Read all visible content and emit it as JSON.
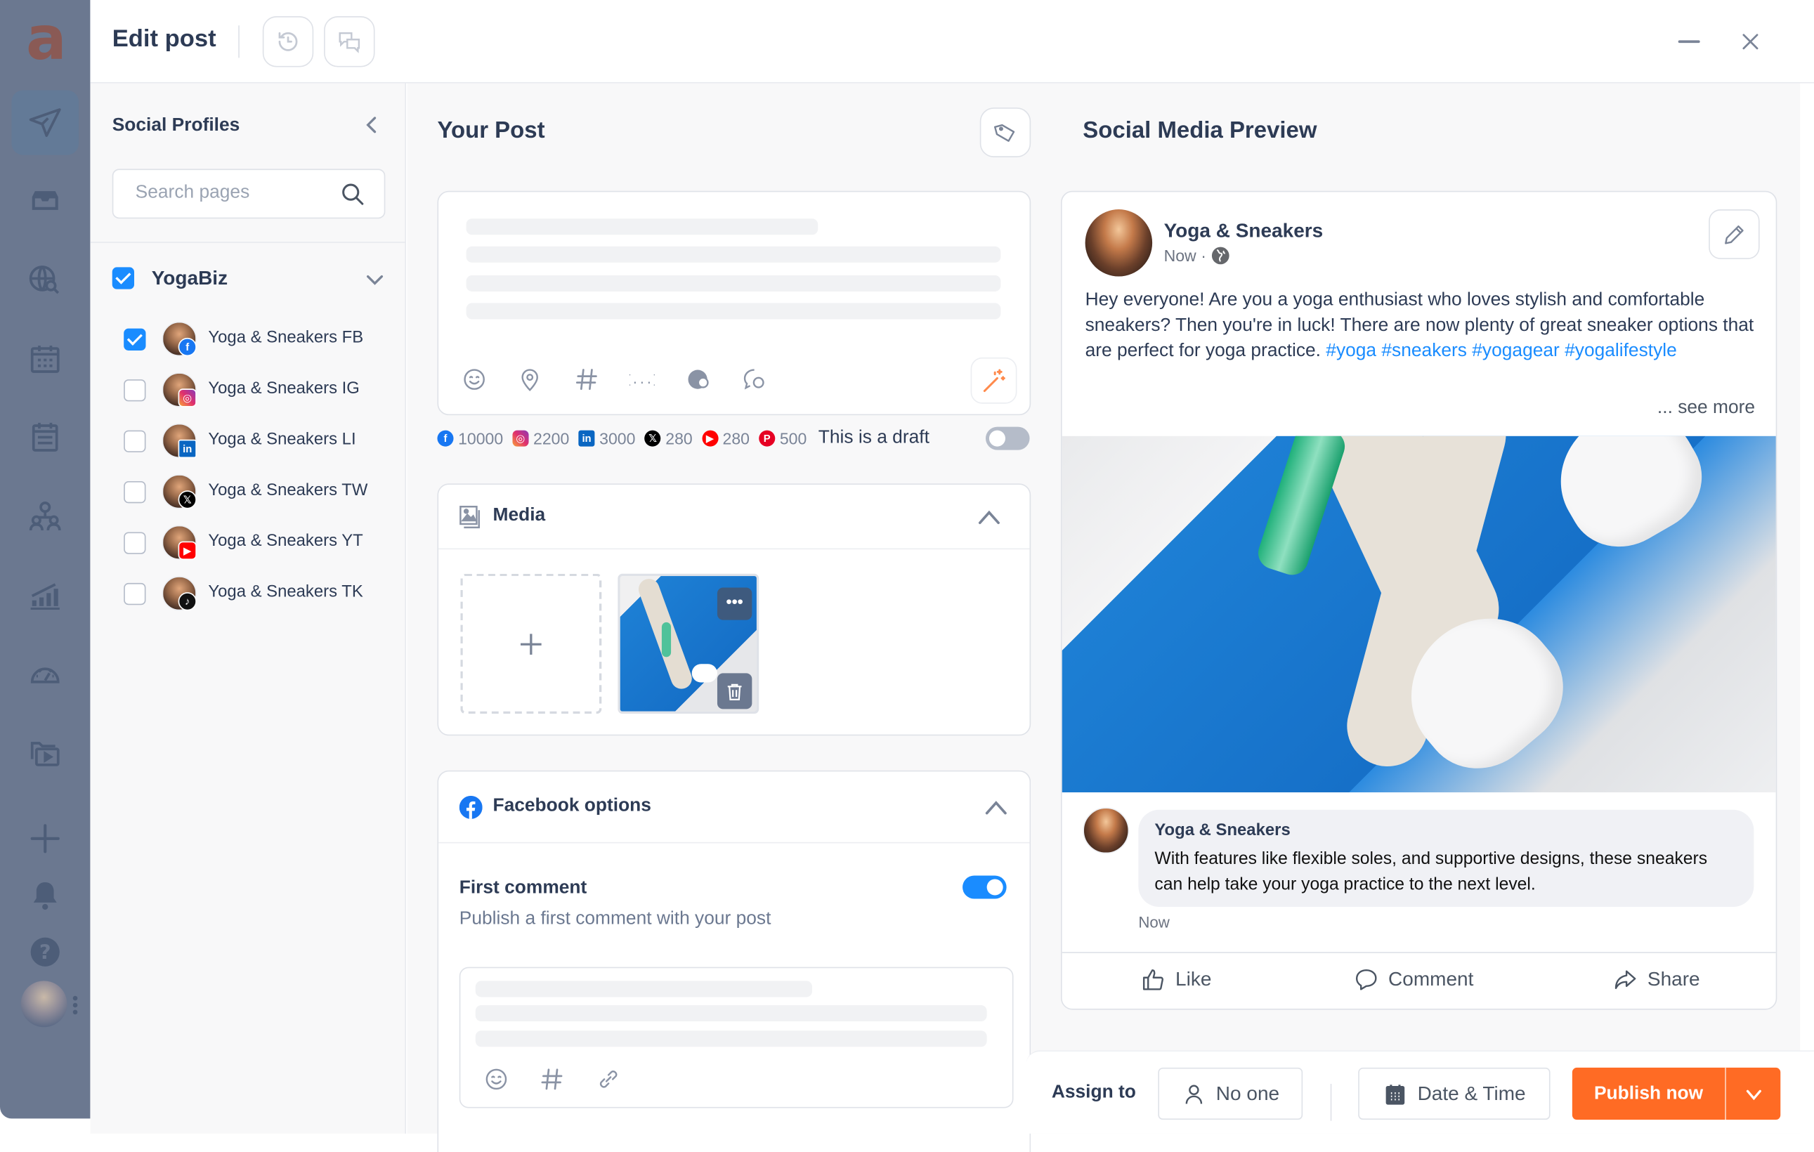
{
  "header": {
    "title": "Edit post",
    "history_button": "history-icon",
    "comments_button": "comments-icon",
    "minimize": "minimize-icon",
    "close": "close-icon"
  },
  "rail": {
    "logo": "a",
    "items": [
      {
        "name": "publish",
        "icon": "paper-plane-icon",
        "active": true
      },
      {
        "name": "inbox",
        "icon": "inbox-icon"
      },
      {
        "name": "listening",
        "icon": "globe-search-icon"
      },
      {
        "name": "calendar",
        "icon": "calendar-icon"
      },
      {
        "name": "content-calendar",
        "icon": "clipboard-calendar-icon"
      },
      {
        "name": "team",
        "icon": "team-icon"
      },
      {
        "name": "analytics",
        "icon": "chart-icon"
      },
      {
        "name": "dashboard",
        "icon": "gauge-icon"
      },
      {
        "name": "media-library",
        "icon": "media-folder-icon"
      },
      {
        "name": "create",
        "icon": "plus-icon"
      },
      {
        "name": "notifications",
        "icon": "bell-icon"
      },
      {
        "name": "help",
        "icon": "help-icon"
      },
      {
        "name": "user",
        "icon": "user-avatar"
      }
    ]
  },
  "profiles": {
    "title": "Social Profiles",
    "search_placeholder": "Search pages",
    "group": {
      "name": "YogaBiz",
      "checked": true
    },
    "items": [
      {
        "name": "Yoga & Sneakers FB",
        "network": "facebook",
        "checked": true
      },
      {
        "name": "Yoga & Sneakers IG",
        "network": "instagram",
        "checked": false
      },
      {
        "name": "Yoga & Sneakers LI",
        "network": "linkedin",
        "checked": false
      },
      {
        "name": "Yoga & Sneakers TW",
        "network": "x",
        "checked": false
      },
      {
        "name": "Yoga & Sneakers YT",
        "network": "youtube",
        "checked": false
      },
      {
        "name": "Yoga & Sneakers TK",
        "network": "tiktok",
        "checked": false
      }
    ]
  },
  "post": {
    "title": "Your Post",
    "toolbar": [
      "emoji-icon",
      "location-icon",
      "hashtag-icon",
      "variables-icon",
      "globe-target-icon",
      "chat-target-icon"
    ],
    "counters": [
      {
        "network": "facebook",
        "limit": "10000",
        "color": "#1877f2"
      },
      {
        "network": "instagram",
        "limit": "2200",
        "color": "#e1306c"
      },
      {
        "network": "linkedin",
        "limit": "3000",
        "color": "#0a66c2"
      },
      {
        "network": "x",
        "limit": "280",
        "color": "#000000"
      },
      {
        "network": "youtube",
        "limit": "280",
        "color": "#ff0000"
      },
      {
        "network": "pinterest",
        "limit": "500",
        "color": "#e60023"
      }
    ],
    "draft_label": "This is a draft",
    "draft_on": false,
    "media": {
      "title": "Media"
    },
    "facebook_options": {
      "title": "Facebook options",
      "first_comment_label": "First comment",
      "first_comment_desc": "Publish a first comment with your post",
      "first_comment_on": true
    }
  },
  "preview": {
    "title": "Social Media Preview",
    "page_name": "Yoga & Sneakers",
    "time": "Now",
    "meta_sep": "·",
    "text": "Hey everyone! Are you a yoga enthusiast who loves stylish and comfortable sneakers? Then you're in luck! There are now plenty of great sneaker options that are perfect for yoga practice.",
    "hashtags": "#yoga #sneakers #yogagear #yogalifestyle",
    "see_more": "... see more",
    "comment": {
      "name": "Yoga & Sneakers",
      "text": "With features like flexible soles, and supportive designs, these sneakers can help take your yoga practice to the next level.",
      "time": "Now"
    },
    "actions": {
      "like": "Like",
      "comment": "Comment",
      "share": "Share"
    }
  },
  "footer": {
    "assign_label": "Assign to",
    "assignee": "No one",
    "datetime": "Date & Time",
    "publish": "Publish now",
    "accent": "#ff6b24"
  }
}
